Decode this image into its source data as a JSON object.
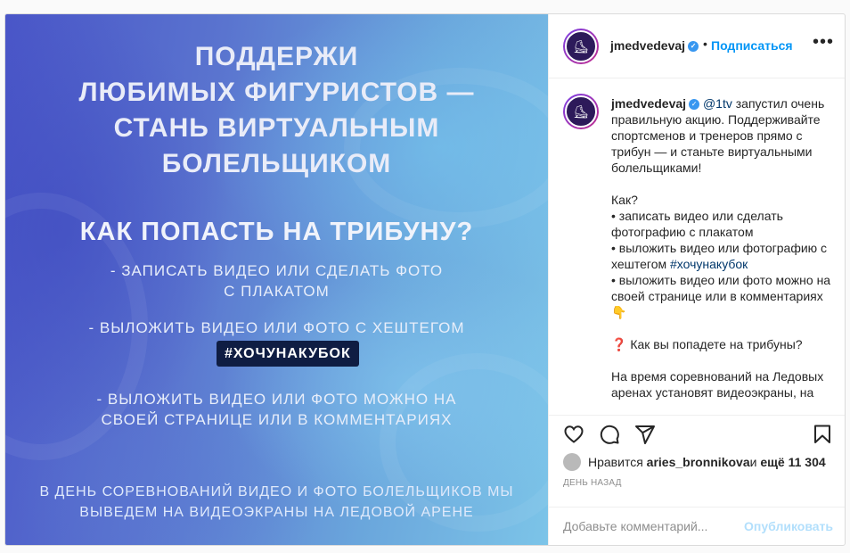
{
  "media": {
    "title_line1": "ПОДДЕРЖИ",
    "title_line2": "ЛЮБИМЫХ ФИГУРИСТОВ —",
    "title_line3": "СТАНЬ ВИРТУАЛЬНЫМ",
    "title_line4": "БОЛЕЛЬЩИКОМ",
    "subtitle": "КАК ПОПАСТЬ НА ТРИБУНУ?",
    "bullet1_line1": "- ЗАПИСАТЬ ВИДЕО ИЛИ СДЕЛАТЬ ФОТО",
    "bullet1_line2": "С ПЛАКАТОМ",
    "bullet2": "- ВЫЛОЖИТЬ ВИДЕО ИЛИ ФОТО С ХЕШТЕГОМ",
    "hashtag": "#ХОЧУНАКУБОК",
    "bullet3_line1": "- ВЫЛОЖИТЬ ВИДЕО ИЛИ ФОТО МОЖНО НА",
    "bullet3_line2": "СВОЕЙ СТРАНИЦЕ ИЛИ В КОММЕНТАРИЯХ",
    "footer_line1": "В ДЕНЬ СОРЕВНОВАНИЙ ВИДЕО И ФОТО БОЛЕЛЬЩИКОВ МЫ",
    "footer_line2": "ВЫВЕДЕМ НА ВИДЕОЭКРАНЫ НА ЛЕДОВОЙ АРЕНЕ"
  },
  "header": {
    "username": "jmedvedevaj",
    "separator": "•",
    "follow_label": "Подписаться",
    "more_label": "•••"
  },
  "caption": {
    "username": "jmedvedevaj",
    "mention": "@1tv",
    "p1_rest": " запустил очень правильную акцию. Поддерживайте спортсменов и тренеров прямо с трибун — и станьте виртуальными болельщиками!",
    "how": "Как?",
    "item1": "• записать видео или сделать фотографию с плакатом",
    "item2_pre": "• выложить видео или фотографию с хештегом ",
    "item2_tag": "#хочунакубок",
    "item3": "• выложить видео или фото можно на своей странице или в комментариях 👇",
    "question": "❓ Как вы попадете на трибуны?",
    "last": "На время соревнований на Ледовых аренах установят видеоэкраны, на"
  },
  "likes": {
    "prefix": "Нравится ",
    "user": "aries_bronnikova",
    "middle": " и ",
    "count": "ещё 11 304"
  },
  "time": "ДЕНЬ НАЗАД",
  "comment": {
    "placeholder": "Добавьте комментарий...",
    "publish_label": "Опубликовать"
  },
  "icons": {
    "like": "heart-icon",
    "comment": "comment-icon",
    "share": "share-icon",
    "save": "bookmark-icon",
    "verified": "verified-badge-icon"
  },
  "colors": {
    "accent": "#0095f6",
    "verified": "#3897f0",
    "hashtag_box": "#0f1d43"
  }
}
